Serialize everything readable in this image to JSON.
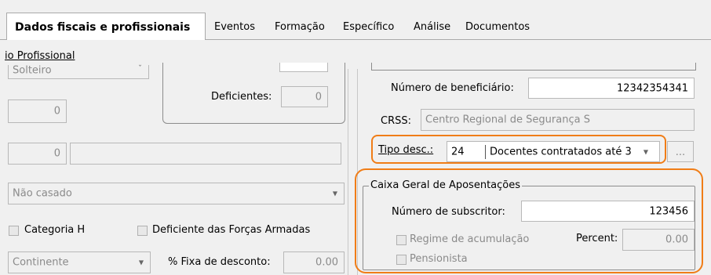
{
  "tabs": [
    {
      "label": "Dados fiscais e profissionais",
      "active": true
    },
    {
      "label": "Eventos"
    },
    {
      "label": "Formação"
    },
    {
      "label": "Específico"
    },
    {
      "label": "Análise"
    },
    {
      "label": "Documentos"
    }
  ],
  "section_link": "io Profissional",
  "left": {
    "estado_civil": "Solteiro",
    "deficientes_label": "Deficientes:",
    "deficientes_value": "0",
    "field_a_value": "0",
    "field_b_value": "0",
    "casado_select": "Não casado",
    "categoria_h_label": "Categoria H",
    "deficiente_fa_label": "Deficiente das Forças Armadas",
    "regiao_select": "Continente",
    "fixa_desconto_label": "% Fixa de desconto:",
    "fixa_desconto_value": "0.00"
  },
  "right": {
    "beneficiario_label": "Número de beneficiário:",
    "beneficiario_value": "12342354341",
    "crss_label": "CRSS:",
    "crss_value": "Centro Regional de Segurança S",
    "tipo_desc_label": "Tipo desc.:",
    "tipo_desc_code": "24",
    "tipo_desc_text": "Docentes contratados até 3",
    "ellipsis_label": "...",
    "cga_group_label": "Caixa Geral de Aposentações",
    "subscritor_label": "Número de subscritor:",
    "subscritor_value": "123456",
    "regime_label": "Regime de acumulação",
    "percent_label": "Percent:",
    "percent_value": "0.00",
    "pensionista_label": "Pensionista"
  },
  "colors": {
    "highlight": "#f07d17"
  }
}
